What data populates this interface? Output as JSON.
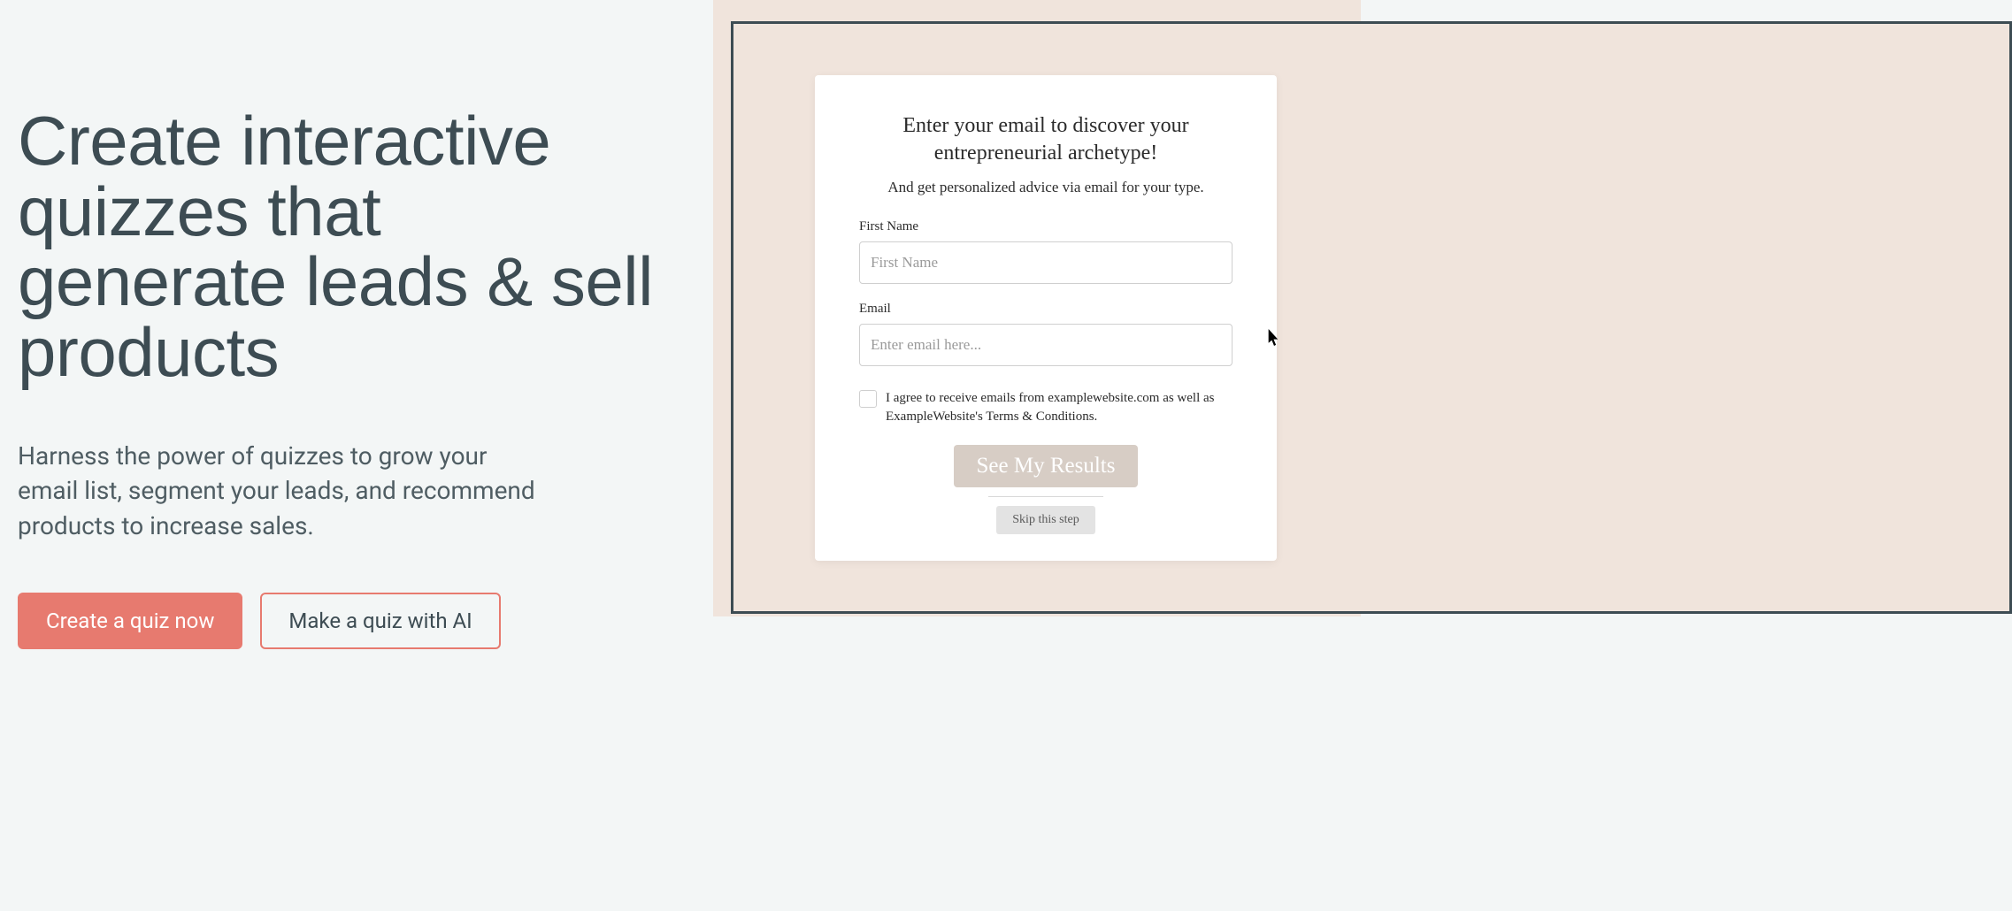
{
  "hero": {
    "headline": "Create interactive quizzes that generate leads & sell products",
    "subhead": "Harness the power of quizzes to grow your email list, segment your leads, and recommend products to increase sales.",
    "primary_cta": "Create a quiz now",
    "secondary_cta": "Make a quiz with AI"
  },
  "form": {
    "title": "Enter your email to discover your entrepreneurial archetype!",
    "subtitle": "And get personalized advice via email for your type.",
    "first_name_label": "First Name",
    "first_name_placeholder": "First Name",
    "email_label": "Email",
    "email_placeholder": "Enter email here...",
    "agree_text": "I agree to receive emails from examplewebsite.com as well as ExampleWebsite's Terms & Conditions.",
    "submit_label": "See My Results",
    "skip_label": "Skip this step"
  },
  "colors": {
    "accent": "#e77a6f",
    "peach": "#f0e4dc",
    "page_bg": "#f3f6f6",
    "text": "#3d4c53"
  }
}
